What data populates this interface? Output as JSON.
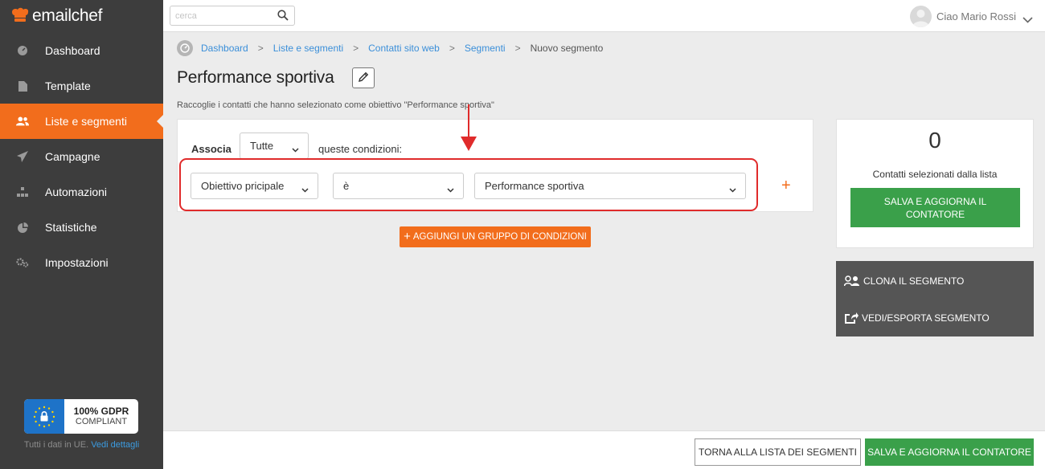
{
  "app": {
    "logo_text": "emailchef"
  },
  "colors": {
    "accent": "#f26d1c",
    "sidebar_bg": "#3d3d3d",
    "green": "#3aa04a",
    "link": "#3b8fd9",
    "highlight": "#e02b2b"
  },
  "sidebar": {
    "items": [
      {
        "label": "Dashboard",
        "icon": "dashboard-icon",
        "active": false
      },
      {
        "label": "Template",
        "icon": "template-icon",
        "active": false
      },
      {
        "label": "Liste e segmenti",
        "icon": "users-icon",
        "active": true
      },
      {
        "label": "Campagne",
        "icon": "paper-plane-icon",
        "active": false
      },
      {
        "label": "Automazioni",
        "icon": "automation-icon",
        "active": false
      },
      {
        "label": "Statistiche",
        "icon": "pie-chart-icon",
        "active": false
      },
      {
        "label": "Impostazioni",
        "icon": "gears-icon",
        "active": false
      }
    ],
    "gdpr": {
      "line1": "100% GDPR",
      "line2": "COMPLIANT",
      "note": "Tutti i dati in UE.",
      "note_link": "Vedi dettagli"
    }
  },
  "topbar": {
    "search_placeholder": "cerca",
    "user_greeting": "Ciao Mario Rossi"
  },
  "breadcrumb": {
    "links": [
      "Dashboard",
      "Liste e segmenti",
      "Contatti sito web",
      "Segmenti"
    ],
    "current": "Nuovo segmento"
  },
  "page": {
    "title": "Performance sportiva",
    "subtitle": "Raccoglie i contatti che hanno selezionato come obiettivo \"Performance sportiva\""
  },
  "conditions": {
    "associa_label": "Associa",
    "match_value": "Tutte",
    "suffix": "queste condizioni:",
    "field": "Obiettivo pricipale",
    "operator": "è",
    "value": "Performance sportiva",
    "add_group_label": "AGGIUNGI UN GRUPPO DI CONDIZIONI"
  },
  "counter": {
    "value": "0",
    "label": "Contatti selezionati dalla lista",
    "button": "SALVA E AGGIORNA IL CONTATORE"
  },
  "actions": {
    "clone": "CLONA IL SEGMENTO",
    "export": "VEDI/ESPORTA SEGMENTO"
  },
  "footer": {
    "back": "TORNA ALLA LISTA DEI SEGMENTI",
    "save": "SALVA E AGGIORNA IL CONTATORE"
  }
}
